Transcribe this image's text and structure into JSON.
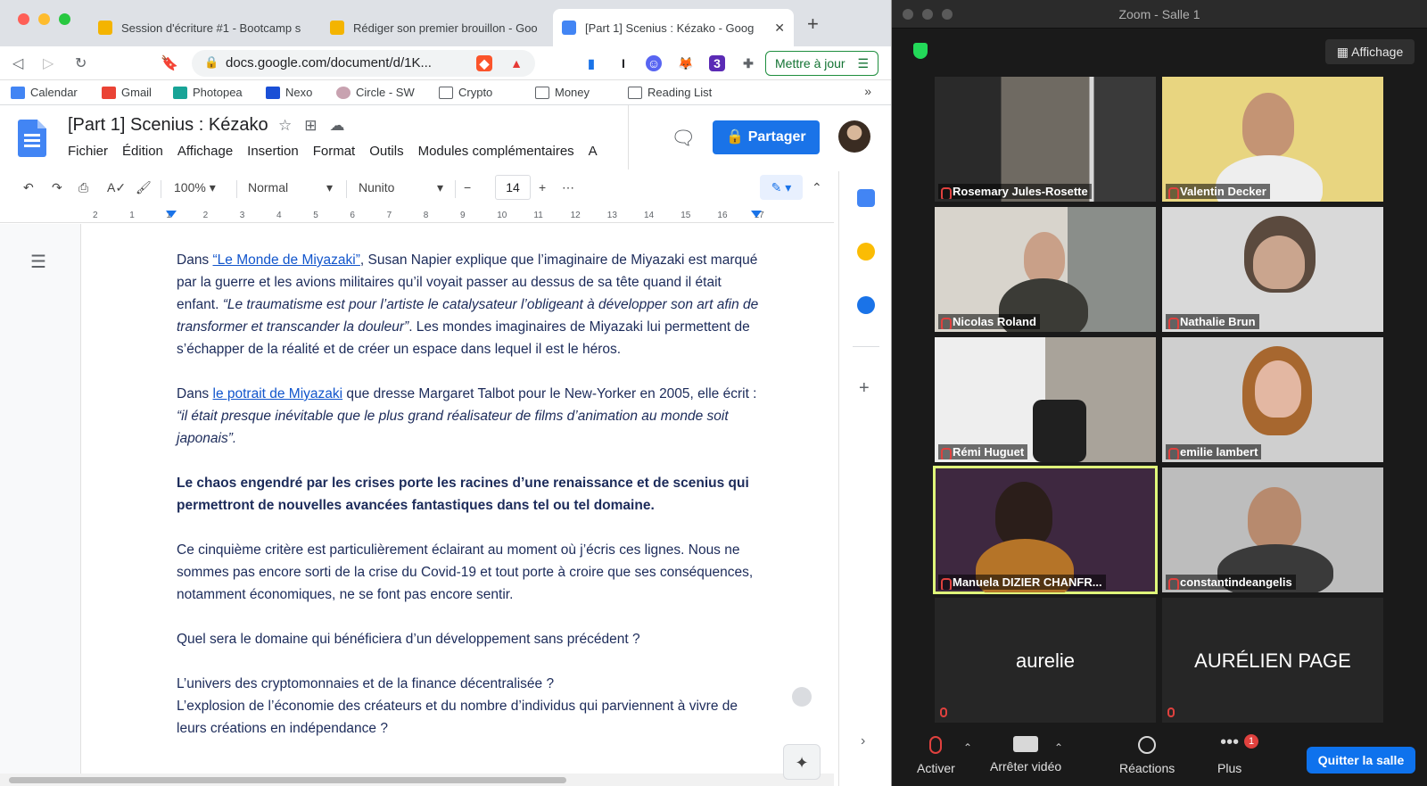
{
  "chrome": {
    "tabs": [
      {
        "title": "Session d'écriture #1 - Bootcamp s",
        "icon": "slides-icon"
      },
      {
        "title": "Rédiger son premier brouillon - Goo",
        "icon": "slides-icon"
      },
      {
        "title": "[Part 1] Scenius : Kézako - Goog",
        "icon": "docs-icon",
        "active": true
      }
    ],
    "url": "docs.google.com/document/d/1K...",
    "update_label": "Mettre à jour",
    "bookmarks": [
      "Calendar",
      "Gmail",
      "Photopea",
      "Nexo",
      "Circle - SW",
      "Crypto",
      "Money",
      "Reading List"
    ],
    "more_bookmarks": "»"
  },
  "docs": {
    "title": "[Part 1] Scenius : Kézako",
    "menu": [
      "Fichier",
      "Édition",
      "Affichage",
      "Insertion",
      "Format",
      "Outils",
      "Modules complémentaires",
      "A"
    ],
    "share_label": "Partager",
    "zoom": "100%",
    "style": "Normal",
    "font": "Nunito",
    "font_size": "14",
    "ruler": [
      "2",
      "1",
      "1",
      "2",
      "3",
      "4",
      "5",
      "6",
      "7",
      "8",
      "9",
      "10",
      "11",
      "12",
      "13",
      "14",
      "15",
      "16",
      "17"
    ],
    "p1": {
      "a": "Dans ",
      "link": "“Le Monde de Miyazaki”",
      "b": ", Susan Napier explique que l’imaginaire de Miyazaki est marqué par la guerre et les avions militaires qu’il voyait passer au dessus de sa tête quand il était enfant. ",
      "em": "“Le traumatisme est pour l’artiste le catalysateur l’obligeant à développer son art afin de transformer et transcander la douleur”",
      "c": ". Les mondes imaginaires de Miyazaki lui permettent de s’échapper de la réalité et de créer un espace dans lequel il est le héros."
    },
    "p2": {
      "a": "Dans ",
      "link": "le potrait de Miyazaki",
      "b": " que dresse Margaret Talbot pour le New-Yorker en 2005, elle écrit : ",
      "em": "“il était presque inévitable que le plus grand réalisateur de films d’animation au monde soit japonais”."
    },
    "p3": "Le chaos engendré par les crises porte les racines d’une renaissance et de scenius qui permettront de nouvelles avancées fantastiques dans tel ou tel domaine.",
    "p4": "Ce cinquième critère est particulièrement éclairant au moment où j’écris ces lignes. Nous ne sommes pas encore sorti de la crise du Covid-19 et tout porte à croire que ses conséquences, notamment économiques, ne se font pas encore sentir.",
    "p5": "Quel sera le domaine qui bénéficiera d’un développement sans précédent ?",
    "p6": "L’univers des cryptomonnaies et de la finance décentralisée ?",
    "p7": "L’explosion de l’économie des créateurs et du nombre d’individus qui parviennent à vivre de leurs créations en indépendance ?"
  },
  "zoom": {
    "window_title": "Zoom - Salle 1",
    "view_label": "Affichage",
    "participants": [
      {
        "name": "Rosemary Jules-Rosette",
        "video": true
      },
      {
        "name": "Valentin Decker",
        "video": true
      },
      {
        "name": "Nicolas Roland",
        "video": true
      },
      {
        "name": "Nathalie Brun",
        "video": true
      },
      {
        "name": "Rémi Huguet",
        "video": true
      },
      {
        "name": "emilie lambert",
        "video": true
      },
      {
        "name": "Manuela DIZIER CHANFR...",
        "video": true,
        "speaking": true
      },
      {
        "name": "constantindeangelis",
        "video": true
      },
      {
        "name": "aurelie",
        "video": false
      },
      {
        "name": "AURÉLIEN PAGE",
        "video": false
      }
    ],
    "controls": {
      "mute": "Activer",
      "video": "Arrêter vidéo",
      "reactions": "Réactions",
      "more": "Plus",
      "more_badge": "1",
      "leave": "Quitter la salle"
    },
    "accent": "#0e72ed",
    "speaker_color": "#dff97a"
  }
}
